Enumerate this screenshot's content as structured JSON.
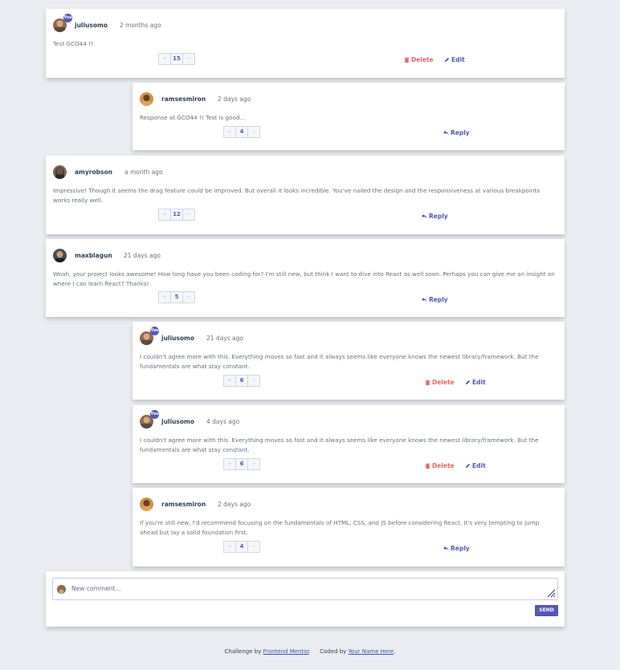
{
  "colors": {
    "accent": "#5457b6",
    "delete": "#ed6368",
    "background": "#eaecf1"
  },
  "labels": {
    "you": "You",
    "reply": "Reply",
    "delete": "Delete",
    "edit": "Edit",
    "plus": "+",
    "minus": "−"
  },
  "comments": [
    {
      "user": "juliusomo",
      "time": "2 months ago",
      "text": "Test GCO44 !!",
      "score": "15"
    },
    {
      "user": "ramsesmiron",
      "time": "2 days ago",
      "text": "Response at GCO44 !! Test is good...",
      "score": "4"
    },
    {
      "user": "amyrobson",
      "time": "a month ago",
      "text": "Impressive! Though it seems the drag feature could be improved. But overall it looks incredible. You've nailed the design and the responsiveness at various breakpoints works really well.",
      "score": "12"
    },
    {
      "user": "maxblagun",
      "time": "21 days ago",
      "text": "Woah, your project looks awesome! How long have you been coding for? I'm still new, but think I want to dive into React as well soon. Perhaps you can give me an insight on where I can learn React? Thanks!",
      "score": "5"
    },
    {
      "user": "juliusomo",
      "time": "21 days ago",
      "text": "I couldn't agree more with this. Everything moves so fast and it always seems like everyone knows the newest library/framework. But the fundamentals are what stay constant.",
      "score": "6"
    },
    {
      "user": "juliusomo",
      "time": "4 days ago",
      "text": "I couldn't agree more with this. Everything moves so fast and it always seems like everyone knows the newest library/framework. But the fundamentals are what stay constant.",
      "score": "6"
    },
    {
      "user": "ramsesmiron",
      "time": "2 days ago",
      "text": "If you're still new, I'd recommend focusing on the fundamentals of HTML, CSS, and JS before considering React. It's very tempting to jump ahead but lay a solid foundation first.",
      "score": "4"
    }
  ],
  "new_comment": {
    "placeholder": "New comment...",
    "send": "SEND"
  },
  "footer": {
    "challenge": "Challenge by",
    "fm": "Frontend Mentor",
    "sep": ".",
    "coded": "Coded by",
    "name": "Your Name Here",
    "end": "."
  }
}
